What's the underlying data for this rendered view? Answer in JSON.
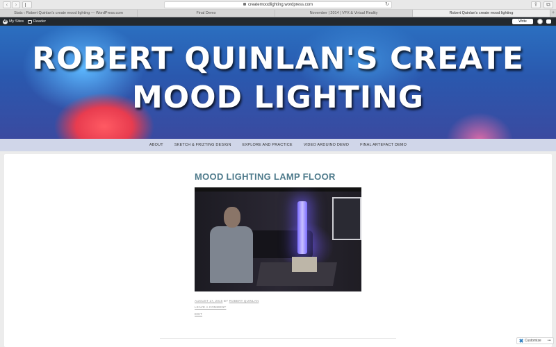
{
  "browser": {
    "url": "createmoodlighting.wordpress.com",
    "nav_back": "‹",
    "nav_forward": "›",
    "reload_glyph": "↻",
    "share_glyph": "⇪",
    "tabs_glyph": "⧉",
    "new_tab_glyph": "+",
    "tabs": [
      {
        "label": "Stats ‹ Robert Quinlan's create mood lighting — WordPress.com",
        "active": false
      },
      {
        "label": "Final Demo",
        "active": false
      },
      {
        "label": "November | 2014 | VFX & Virtual Reality",
        "active": false
      },
      {
        "label": "Robert Quinlan's create mood lighting",
        "active": true
      }
    ]
  },
  "admin_bar": {
    "my_sites": "My Sites",
    "reader": "Reader",
    "write": "Write",
    "wp_glyph": "W"
  },
  "site": {
    "title_line1": "ROBERT QUINLAN'S CREATE",
    "title_line2": "MOOD LIGHTING"
  },
  "menu": {
    "items": [
      "ABOUT",
      "SKETCH & FRIZTING DESIGN",
      "EXPLORE AND PRACTICE",
      "VIDEO ARDUINO DEMO",
      "FINAL ARTEFACT DEMO"
    ]
  },
  "post": {
    "title": "MOOD LIGHTING LAMP FLOOR",
    "date": "AUGUST 17, 2016",
    "by": "BY",
    "author": "ROBERT QUINLAN",
    "comment": "LEAVE A COMMENT",
    "edit": "EDIT"
  },
  "customize": {
    "label": "Customize",
    "more": "•••"
  },
  "colors": {
    "admin_bar_bg": "#23282d",
    "post_title": "#4e7a8b",
    "header_blue": "#2a58ae",
    "cube_red": "#ff5a63"
  }
}
